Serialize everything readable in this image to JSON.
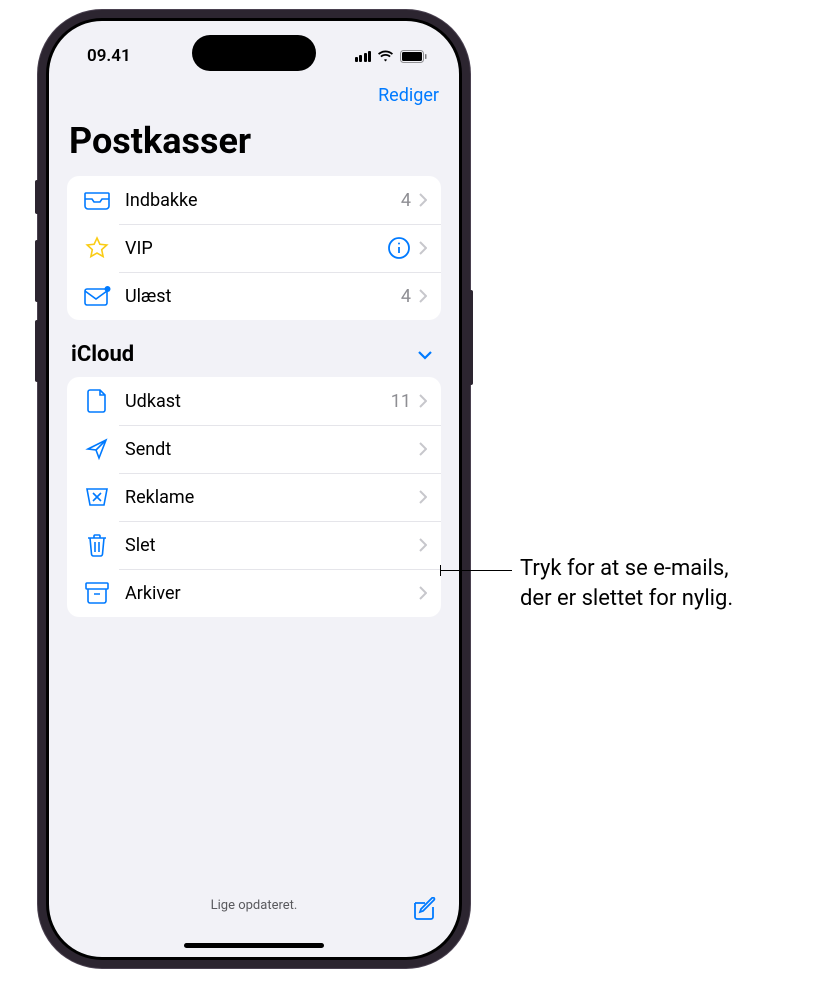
{
  "status": {
    "time": "09.41"
  },
  "nav": {
    "edit": "Rediger"
  },
  "title": "Postkasser",
  "mailboxes": [
    {
      "icon": "inbox",
      "label": "Indbakke",
      "count": "4"
    },
    {
      "icon": "star",
      "label": "VIP",
      "info": true
    },
    {
      "icon": "unread",
      "label": "Ulæst",
      "count": "4"
    }
  ],
  "section": {
    "title": "iCloud"
  },
  "icloud": [
    {
      "icon": "draft",
      "label": "Udkast",
      "count": "11"
    },
    {
      "icon": "sent",
      "label": "Sendt"
    },
    {
      "icon": "junk",
      "label": "Reklame"
    },
    {
      "icon": "trash",
      "label": "Slet"
    },
    {
      "icon": "archive",
      "label": "Arkiver"
    }
  ],
  "bottom": {
    "status": "Lige opdateret."
  },
  "callout": {
    "line1": "Tryk for at se e-mails,",
    "line2": "der er slettet for nylig."
  }
}
